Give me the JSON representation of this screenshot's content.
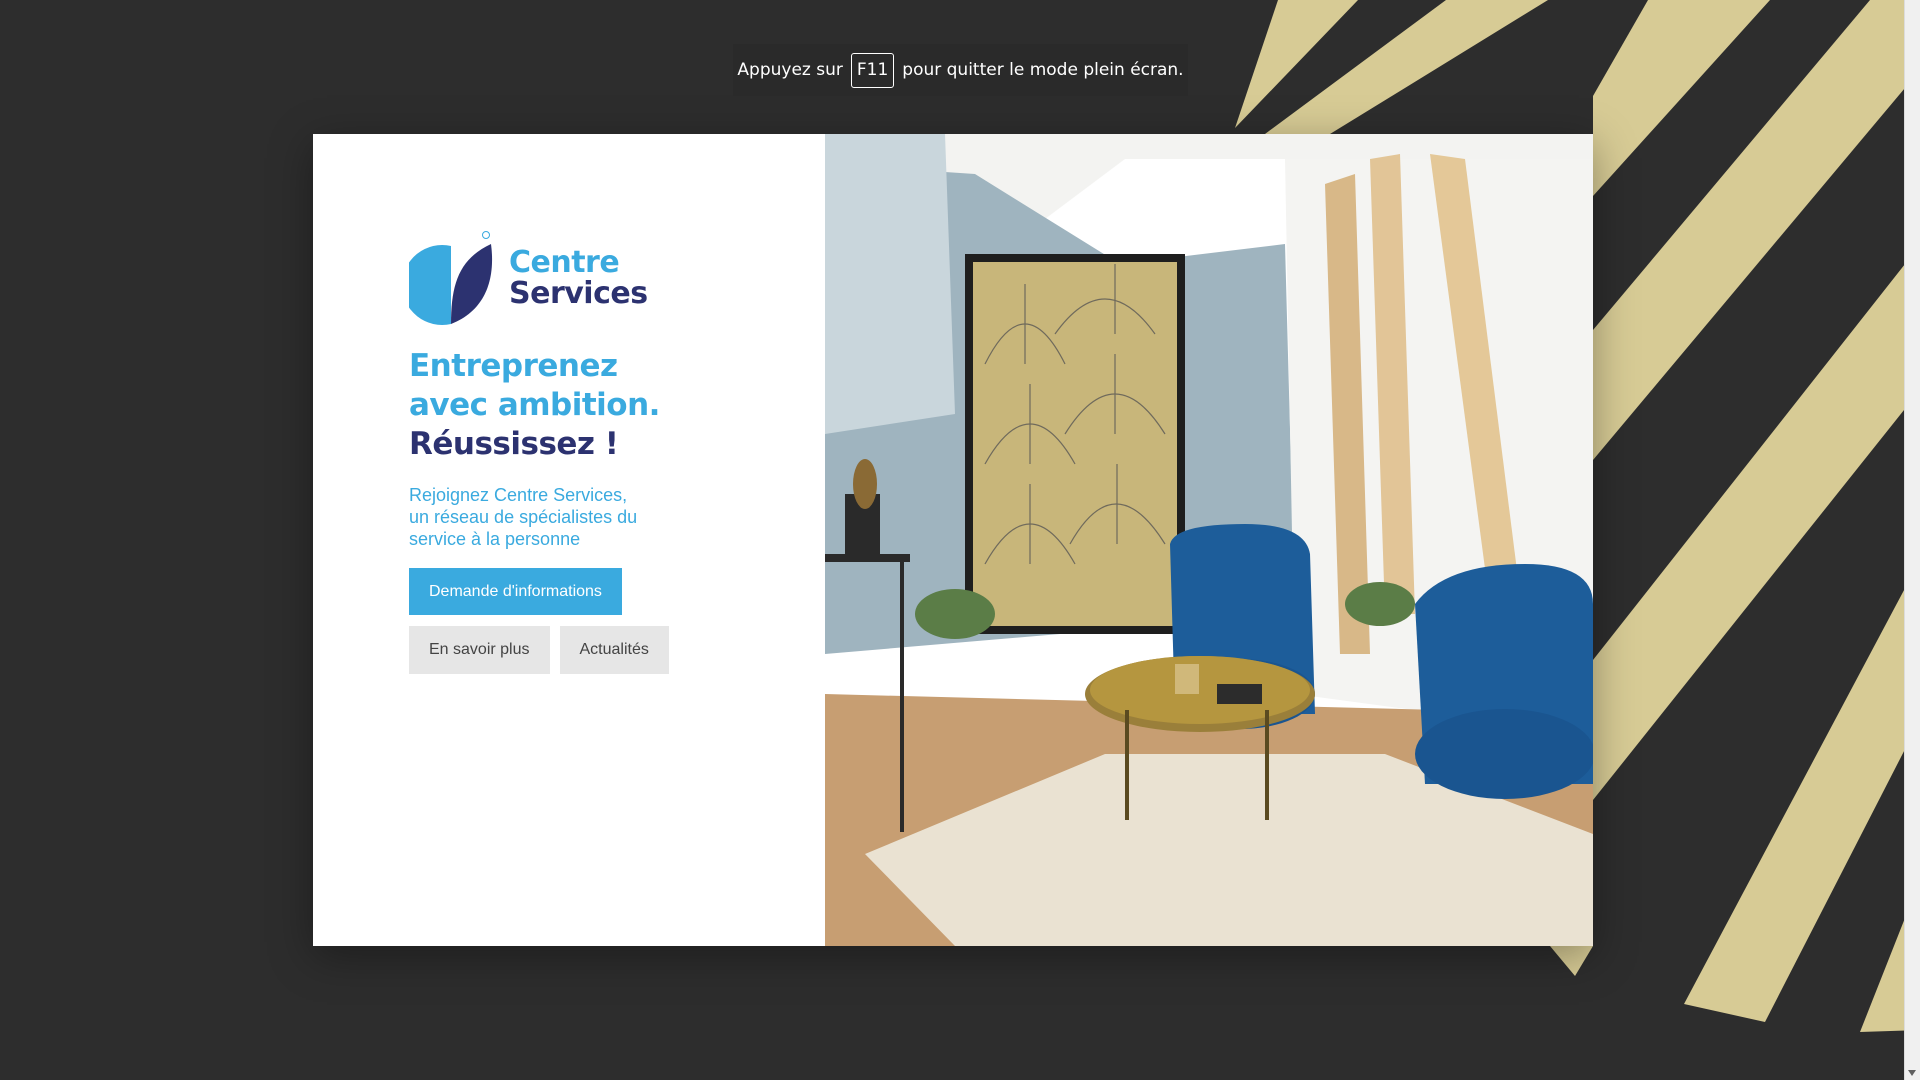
{
  "fullscreen_notice": {
    "before": "Appuyez sur",
    "key": "F11",
    "after": "pour quitter le mode plein écran."
  },
  "logo": {
    "line1": "Centre",
    "line2": "Services",
    "mark": "®"
  },
  "headline": {
    "line1": "Entreprenez",
    "line2": "avec ambition.",
    "line3": "Réussissez !"
  },
  "subtext": "Rejoignez Centre Services, un réseau de spécialistes du service à la personne",
  "buttons": {
    "primary": "Demande d'informations",
    "learn_more": "En savoir plus",
    "news": "Actualités"
  },
  "colors": {
    "brand_light_blue": "#3aaadf",
    "brand_dark_blue": "#2c3270",
    "stripe": "#d7cb95",
    "background": "#2d2d2d"
  },
  "photo": {
    "icon": "office-lounge-photo"
  }
}
